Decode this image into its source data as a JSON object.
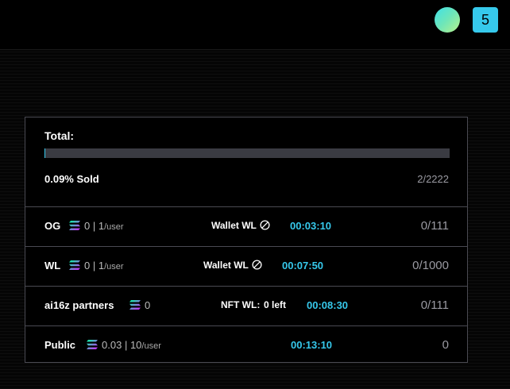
{
  "header": {
    "notification_count": "5",
    "accent_color": "#36c9ec"
  },
  "mint": {
    "total_label": "Total:",
    "progress_fraction": 0.0009,
    "sold_label": "0.09% Sold",
    "sold_count": "2/2222",
    "phases": [
      {
        "name": "OG",
        "currency_icon": "solana-icon",
        "price": "0",
        "separator": "|",
        "limit": "1",
        "limit_unit": "/user",
        "requirement": "Wallet WL",
        "status_icon": "ban-icon",
        "timer": "00:03:10",
        "supply": "0/111"
      },
      {
        "name": "WL",
        "currency_icon": "solana-icon",
        "price": "0",
        "separator": "|",
        "limit": "1",
        "limit_unit": "/user",
        "requirement": "Wallet WL",
        "status_icon": "ban-icon",
        "timer": "00:07:50",
        "supply": "0/1000"
      },
      {
        "name": "ai16z partners",
        "currency_icon": "solana-icon",
        "price": "0",
        "requirement": "NFT WL:",
        "left_text": "0 left",
        "timer": "00:08:30",
        "supply": "0/111"
      },
      {
        "name": "Public",
        "currency_icon": "solana-icon",
        "price": "0.03",
        "separator": "|",
        "limit": "10",
        "limit_unit": "/user",
        "timer": "00:13:10",
        "supply": "0"
      }
    ]
  }
}
